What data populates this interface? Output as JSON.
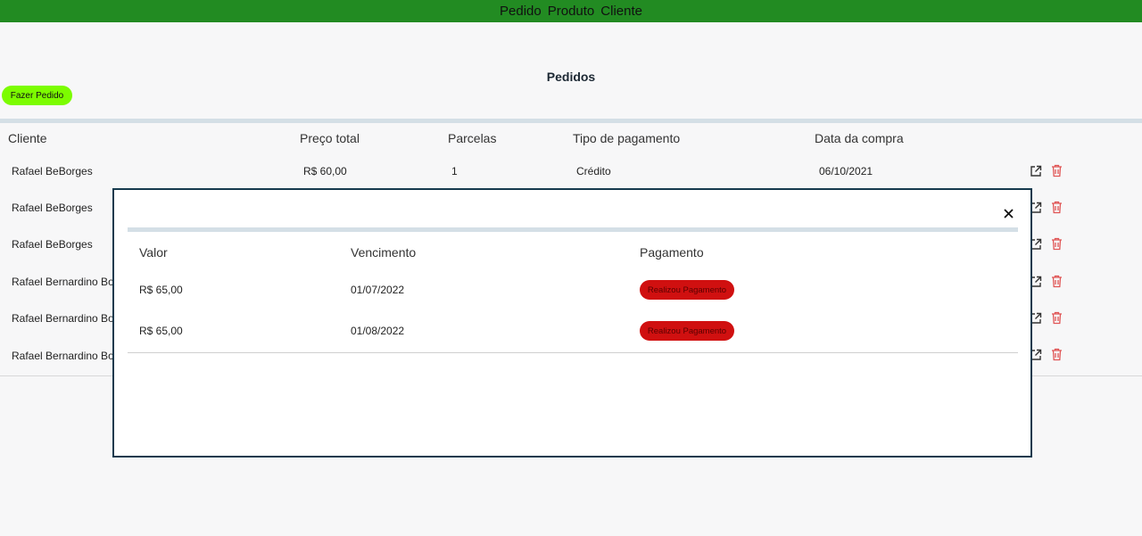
{
  "nav": {
    "items": [
      "Pedido",
      "Produto",
      "Cliente"
    ]
  },
  "page": {
    "title": "Pedidos",
    "new_order_label": "Fazer Pedido"
  },
  "orders": {
    "headers": [
      "Cliente",
      "Preço total",
      "Parcelas",
      "Tipo de pagamento",
      "Data da compra"
    ],
    "rows": [
      {
        "cliente": "Rafael BeBorges",
        "preco": "R$ 60,00",
        "parcelas": "1",
        "tipo": "Crédito",
        "data": "06/10/2021"
      },
      {
        "cliente": "Rafael BeBorges"
      },
      {
        "cliente": "Rafael BeBorges"
      },
      {
        "cliente": "Rafael Bernardino Bo"
      },
      {
        "cliente": "Rafael Bernardino Bo"
      },
      {
        "cliente": "Rafael Bernardino Bo"
      }
    ],
    "icons": [
      "external-link-icon",
      "trash-icon"
    ]
  },
  "modal": {
    "close_icon": "close-icon",
    "headers": [
      "Valor",
      "Vencimento",
      "Pagamento"
    ],
    "rows": [
      {
        "valor": "R$ 65,00",
        "vencimento": "01/07/2022",
        "pagamento": "Realizou Pagamento"
      },
      {
        "valor": "R$ 65,00",
        "vencimento": "01/08/2022",
        "pagamento": "Realizou Pagamento"
      }
    ]
  },
  "colors": {
    "nav_bg": "#228b22",
    "button_bg": "#7cfc00",
    "badge_bg": "#d01010",
    "trash": "#e05555"
  }
}
